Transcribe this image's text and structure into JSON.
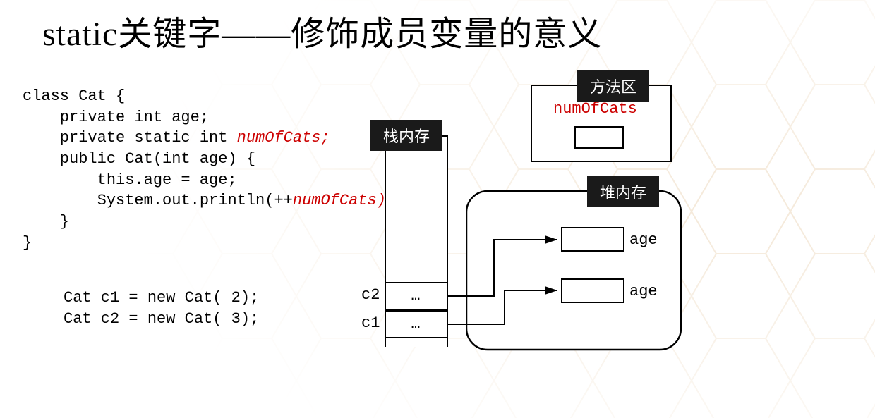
{
  "title": "static关键字——修饰成员变量的意义",
  "code_top": {
    "l1": "class Cat {",
    "l2": "    private int age;",
    "l3a": "    private static int ",
    "l3b": "numOfCats;",
    "l4": "    public Cat(int age) {",
    "l5": "        this.age = age;",
    "l6a": "        System.out.println(++",
    "l6b": "numOfCats);",
    "l7": "    }",
    "l8": "}"
  },
  "code_bottom": {
    "l1": "Cat c1 = new Cat( 2);",
    "l2": "Cat c2 = new Cat( 3);"
  },
  "diagram": {
    "method_area_label": "方法区",
    "stack_label": "栈内存",
    "heap_label": "堆内存",
    "static_var": "numOfCats",
    "c1": "c1",
    "c2": "c2",
    "dots": "…",
    "age": "age"
  }
}
